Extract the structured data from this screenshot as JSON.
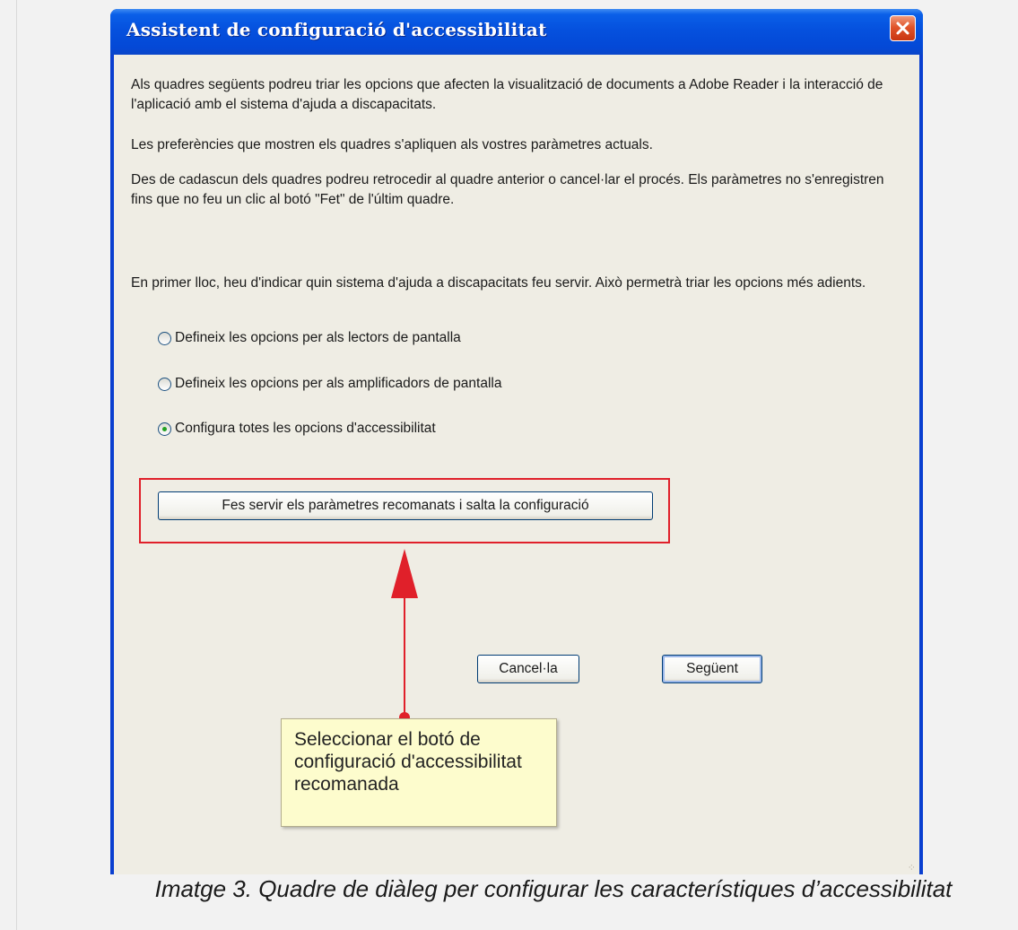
{
  "dialog": {
    "title": "Assistent de configuració d'accessibilitat",
    "intro_1": "Als quadres següents podreu triar les opcions que afecten la visualització de documents a Adobe Reader i la interacció de l'aplicació amb el sistema d'ajuda a discapacitats.",
    "intro_2": "Les preferències que mostren els quadres s'apliquen als vostres paràmetres actuals.",
    "intro_3": "Des de cadascun dels quadres podreu retrocedir al quadre anterior o cancel·lar el procés. Els paràmetres no s'enregistren fins que no feu un clic al botó \"Fet\" de l'últim quadre.",
    "question": "En primer lloc, heu d'indicar quin sistema d'ajuda a discapacitats feu servir. Això permetrà triar les opcions més adients.",
    "options": [
      {
        "label": "Defineix les opcions per als lectors de pantalla",
        "checked": false
      },
      {
        "label": "Defineix les opcions per als amplificadors de pantalla",
        "checked": false
      },
      {
        "label": "Configura totes les opcions d'accessibilitat",
        "checked": true
      }
    ],
    "recommended_button": "Fes servir els paràmetres recomanats i salta la configuració",
    "cancel_button": "Cancel·la",
    "next_button": "Següent"
  },
  "annotation": {
    "callout_text": "Seleccionar el botó de configuració d'accessibilitat recomanada",
    "highlight_color": "#e0202a"
  },
  "caption": "Imatge 3. Quadre de diàleg per configurar les característiques d’accessibilitat",
  "icons": {
    "close": "close-icon"
  }
}
